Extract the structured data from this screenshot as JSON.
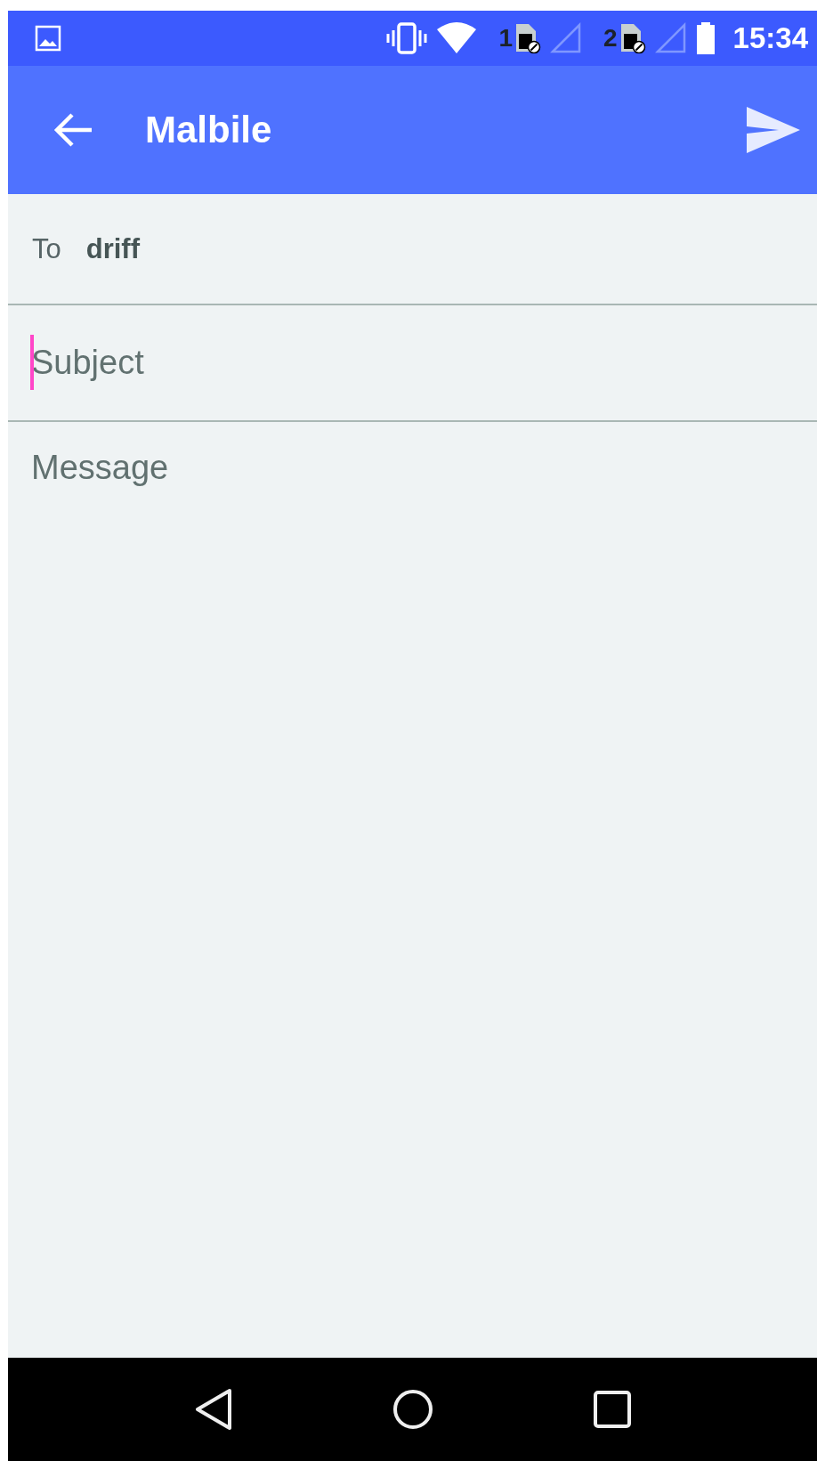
{
  "status_bar": {
    "sims": [
      {
        "label": "1"
      },
      {
        "label": "2"
      }
    ],
    "time": "15:34"
  },
  "app_bar": {
    "title": "Malbile"
  },
  "compose": {
    "to_label": "To",
    "to_value": "driff",
    "subject": {
      "placeholder": "Subject",
      "focused": true
    },
    "message": {
      "placeholder": "Message"
    }
  }
}
